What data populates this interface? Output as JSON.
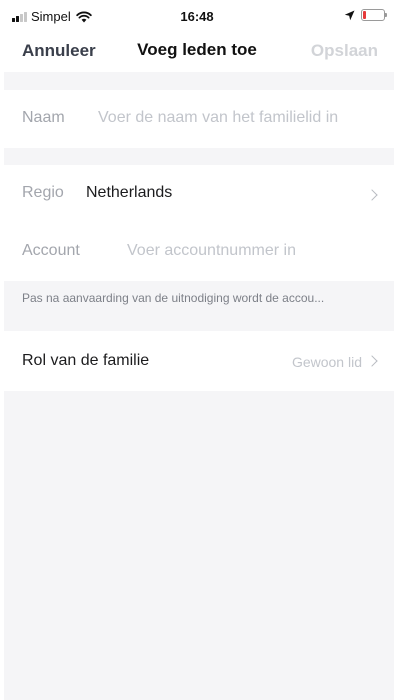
{
  "status_bar": {
    "carrier": "Simpel",
    "time": "16:48",
    "battery_level": 0.15,
    "battery_color": "#e5393a",
    "icons": [
      "signal-icon",
      "wifi-icon",
      "location-arrow-icon",
      "battery-icon"
    ]
  },
  "nav": {
    "cancel_label": "Annuleer",
    "title": "Voeg leden toe",
    "save_label": "Opslaan"
  },
  "form": {
    "naam": {
      "label": "Naam",
      "placeholder": "Voer de naam van het familielid in",
      "value": ""
    },
    "regio": {
      "label": "Regio",
      "value": "Netherlands"
    },
    "account": {
      "label": "Account",
      "placeholder": "Voer accountnummer in",
      "value": ""
    },
    "hint": "Pas na aanvaarding van de uitnodiging wordt de accou...",
    "rol": {
      "label": "Rol van de familie",
      "value": "Gewoon lid"
    }
  },
  "colors": {
    "background": "#f5f5f7",
    "cancel_text": "#3a3f4b",
    "save_disabled": "#d2d4d8",
    "placeholder": "#c2c5cb"
  }
}
